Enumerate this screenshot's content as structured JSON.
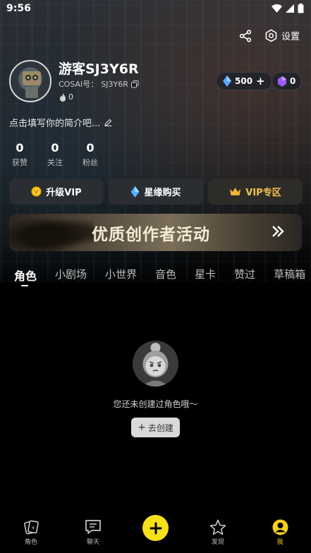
{
  "status": {
    "time": "9:56"
  },
  "header": {
    "settings_label": "设置"
  },
  "profile": {
    "username": "游客SJ3Y6R",
    "id_label": "COSAI号：",
    "id_value": "SJ3Y6R",
    "fire_count": "0",
    "diamonds": "500",
    "gems": "0",
    "bio": "点击填写你的简介吧..."
  },
  "stats": [
    {
      "value": "0",
      "label": "获赞"
    },
    {
      "value": "0",
      "label": "关注"
    },
    {
      "value": "0",
      "label": "粉丝"
    }
  ],
  "actions": {
    "upgrade_vip": "升级VIP",
    "star_purchase": "星缘购买",
    "vip_zone": "VIP专区"
  },
  "banner": {
    "title": "优质创作者活动"
  },
  "tabs": [
    "角色",
    "小剧场",
    "小世界",
    "音色",
    "星卡",
    "赞过",
    "草稿箱"
  ],
  "empty": {
    "message": "您还未创建过角色哦～",
    "button": "去创建"
  },
  "nav": {
    "roles": "角色",
    "chat": "聊天",
    "discover": "发现",
    "me": "我"
  },
  "colors": {
    "accent": "#f5e01a",
    "vip_gold": "#f2c14e",
    "background": "#000000"
  },
  "icons": [
    "share-icon",
    "settings-icon",
    "copy-icon",
    "fire-icon",
    "diamond-icon",
    "gem-icon",
    "edit-icon",
    "coin-icon",
    "crown-icon",
    "double-chevron-icon",
    "cards-icon",
    "chat-icon",
    "plus-icon",
    "star-icon",
    "profile-icon"
  ]
}
